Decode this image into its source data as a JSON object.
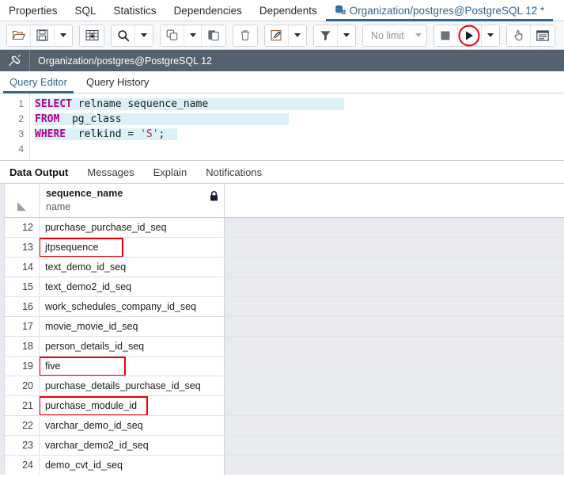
{
  "top_tabs": [
    {
      "label": "Properties",
      "active": false,
      "icon": null
    },
    {
      "label": "SQL",
      "active": false,
      "icon": null
    },
    {
      "label": "Statistics",
      "active": false,
      "icon": null
    },
    {
      "label": "Dependencies",
      "active": false,
      "icon": null
    },
    {
      "label": "Dependents",
      "active": false,
      "icon": null
    },
    {
      "label": "Organization/postgres@PostgreSQL 12 *",
      "active": true,
      "icon": "database-icon"
    }
  ],
  "toolbar": {
    "groups": [
      {
        "buttons": [
          {
            "name": "open-file-button",
            "icon": "open-folder-icon",
            "label": ""
          },
          {
            "name": "save-file-button",
            "icon": "save-disk-icon",
            "label": ""
          },
          {
            "name": "save-options-caret",
            "icon": "chevron-down-icon",
            "label": ""
          }
        ]
      },
      {
        "buttons": [
          {
            "name": "edit-grid-button",
            "icon": "grid-download-icon",
            "label": ""
          }
        ]
      },
      {
        "buttons": [
          {
            "name": "find-button",
            "icon": "search-icon",
            "label": ""
          },
          {
            "name": "find-options-caret",
            "icon": "chevron-down-icon",
            "label": ""
          }
        ]
      },
      {
        "buttons": [
          {
            "name": "copy-button",
            "icon": "copy-icon",
            "label": ""
          },
          {
            "name": "copy-options-caret",
            "icon": "chevron-down-icon",
            "label": ""
          },
          {
            "name": "paste-button",
            "icon": "paste-icon",
            "label": ""
          }
        ]
      },
      {
        "buttons": [
          {
            "name": "delete-row-button",
            "icon": "trash-icon",
            "label": ""
          }
        ]
      },
      {
        "buttons": [
          {
            "name": "edit-button",
            "icon": "pencil-square-icon",
            "label": ""
          },
          {
            "name": "edit-options-caret",
            "icon": "chevron-down-icon",
            "label": ""
          }
        ]
      },
      {
        "buttons": [
          {
            "name": "filter-button",
            "icon": "funnel-icon",
            "label": ""
          },
          {
            "name": "filter-options-caret",
            "icon": "chevron-down-icon",
            "label": ""
          }
        ]
      }
    ],
    "row_limit": {
      "label": "No limit",
      "name": "row-limit-select"
    },
    "stop_button": {
      "name": "stop-query-button",
      "icon": "stop-square-icon"
    },
    "execute_button": {
      "name": "execute-query-button",
      "icon": "play-icon",
      "annotated": true
    },
    "execute_caret": {
      "name": "execute-options-caret",
      "icon": "chevron-down-icon"
    },
    "macro_button": {
      "name": "macros-button",
      "icon": "hand-pointer-icon"
    },
    "panel_button": {
      "name": "panel-toggle-button",
      "icon": "panel-list-icon"
    }
  },
  "connection_bar": {
    "icon": "plug-connected-icon",
    "text": "Organization/postgres@PostgreSQL 12"
  },
  "editor_tabs": [
    {
      "label": "Query Editor",
      "active": true
    },
    {
      "label": "Query History",
      "active": false
    }
  ],
  "sql": {
    "lines": [
      {
        "number": "1",
        "segments": [
          {
            "text": "SELECT",
            "cls": "kw"
          },
          {
            "text": " relname sequence_name",
            "cls": "pln"
          }
        ],
        "selected": true
      },
      {
        "number": "2",
        "segments": [
          {
            "text": "FROM",
            "cls": "kw"
          },
          {
            "text": "  pg_class",
            "cls": "pln"
          }
        ],
        "selected": true
      },
      {
        "number": "3",
        "segments": [
          {
            "text": "WHERE",
            "cls": "kw"
          },
          {
            "text": "  relkind = ",
            "cls": "pln"
          },
          {
            "text": "'S'",
            "cls": "str"
          },
          {
            "text": ";",
            "cls": "pln"
          }
        ],
        "selected": true
      },
      {
        "number": "4",
        "segments": [
          {
            "text": "",
            "cls": "pln"
          }
        ],
        "selected": false
      }
    ]
  },
  "output_tabs": [
    {
      "label": "Data Output",
      "active": true
    },
    {
      "label": "Messages",
      "active": false
    },
    {
      "label": "Explain",
      "active": false
    },
    {
      "label": "Notifications",
      "active": false
    }
  ],
  "grid": {
    "column": {
      "name": "sequence_name",
      "type": "name",
      "lock_icon": "lock-icon"
    },
    "rows": [
      {
        "num": "12",
        "value": "purchase_purchase_id_seq",
        "annotated": false
      },
      {
        "num": "13",
        "value": "jtpsequence",
        "annotated": true
      },
      {
        "num": "14",
        "value": "text_demo_id_seq",
        "annotated": false
      },
      {
        "num": "15",
        "value": "text_demo2_id_seq",
        "annotated": false
      },
      {
        "num": "16",
        "value": "work_schedules_company_id_seq",
        "annotated": false
      },
      {
        "num": "17",
        "value": "movie_movie_id_seq",
        "annotated": false
      },
      {
        "num": "18",
        "value": "person_details_id_seq",
        "annotated": false
      },
      {
        "num": "19",
        "value": "five",
        "annotated": true
      },
      {
        "num": "20",
        "value": "purchase_details_purchase_id_seq",
        "annotated": false
      },
      {
        "num": "21",
        "value": "purchase_module_id",
        "annotated": true
      },
      {
        "num": "22",
        "value": "varchar_demo_id_seq",
        "annotated": false
      },
      {
        "num": "23",
        "value": "varchar_demo2_id_seq",
        "annotated": false
      },
      {
        "num": "24",
        "value": "demo_cvt_id_seq",
        "annotated": false
      }
    ]
  },
  "colors": {
    "accent": "#326690",
    "annotation_red": "#e8000d",
    "connection_bar_bg": "#54626f",
    "grid_empty_bg": "#e8eaef",
    "sql_keyword": "#b3008f",
    "sql_string": "#b03030",
    "sql_selection": "#d9f1f7"
  }
}
